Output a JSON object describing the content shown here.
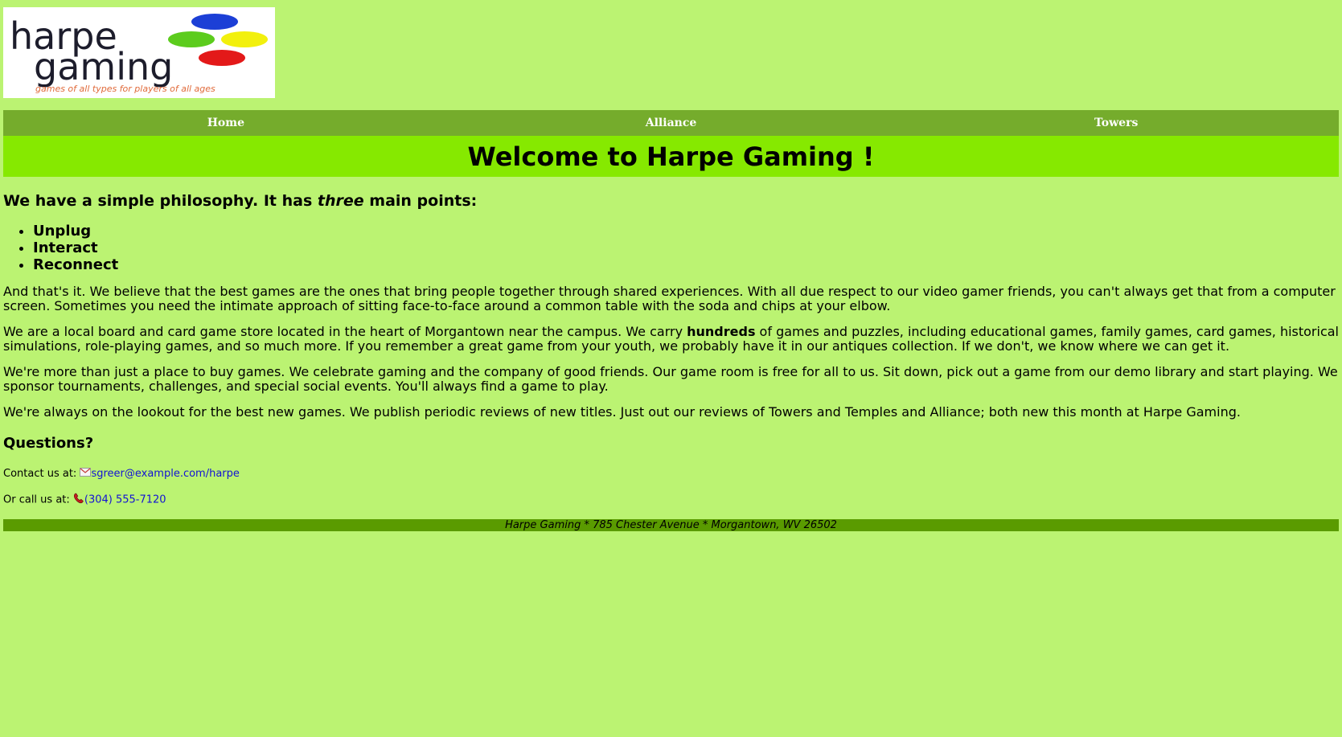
{
  "logo": {
    "line1": "harpe",
    "line2": "gaming",
    "tagline": "games of all types for players of all ages",
    "colors": [
      "#1c3fd6",
      "#5ccc1d",
      "#f2f00d",
      "#e31919"
    ]
  },
  "nav": [
    "Home",
    "Alliance",
    "Towers"
  ],
  "banner": {
    "title": "Welcome to Harpe Gaming !"
  },
  "philosophy": {
    "prefix": "We have a simple philosophy. It has ",
    "emphasis": "three",
    "suffix": " main points:"
  },
  "points": [
    "Unplug",
    "Interact",
    "Reconnect"
  ],
  "paragraphs": {
    "p1": "And that's it. We believe that the best games are the ones that bring people together through shared experiences. With all due respect to our video gamer friends, you can't always get that from a computer screen. Sometimes you need the intimate approach of sitting face-to-face around a common table with the soda and chips at your elbow.",
    "p2_before": "We are a local board and card game store located in the heart of Morgantown near the campus. We carry ",
    "p2_bold": "hundreds",
    "p2_after": " of games and puzzles, including educational games, family games, card games, historical simulations, role-playing games, and so much more. If you remember a great game from your youth, we probably have it in our antiques collection. If we don't, we know where we can get it.",
    "p3": "We're more than just a place to buy games. We celebrate gaming and the company of good friends. Our game room is free for all to us. Sit down, pick out a game from our demo library and start playing. We sponsor tournaments, challenges, and special social events. You'll always find a game to play.",
    "p4": "We're always on the lookout for the best new games. We publish periodic reviews of new titles. Just out our reviews of Towers and Temples and Alliance; both new this month at Harpe Gaming."
  },
  "questions": "Questions?",
  "contact": {
    "email_label": "Contact us at: ",
    "email": "sgreer@example.com/harpe",
    "email_icon": "envelope-icon",
    "phone_label": "Or call us at: ",
    "phone": "(304) 555-7120",
    "phone_icon": "phone-icon",
    "link_color": "#1313d4"
  },
  "footer": "Harpe Gaming * 785 Chester Avenue * Morgantown, WV 26502"
}
